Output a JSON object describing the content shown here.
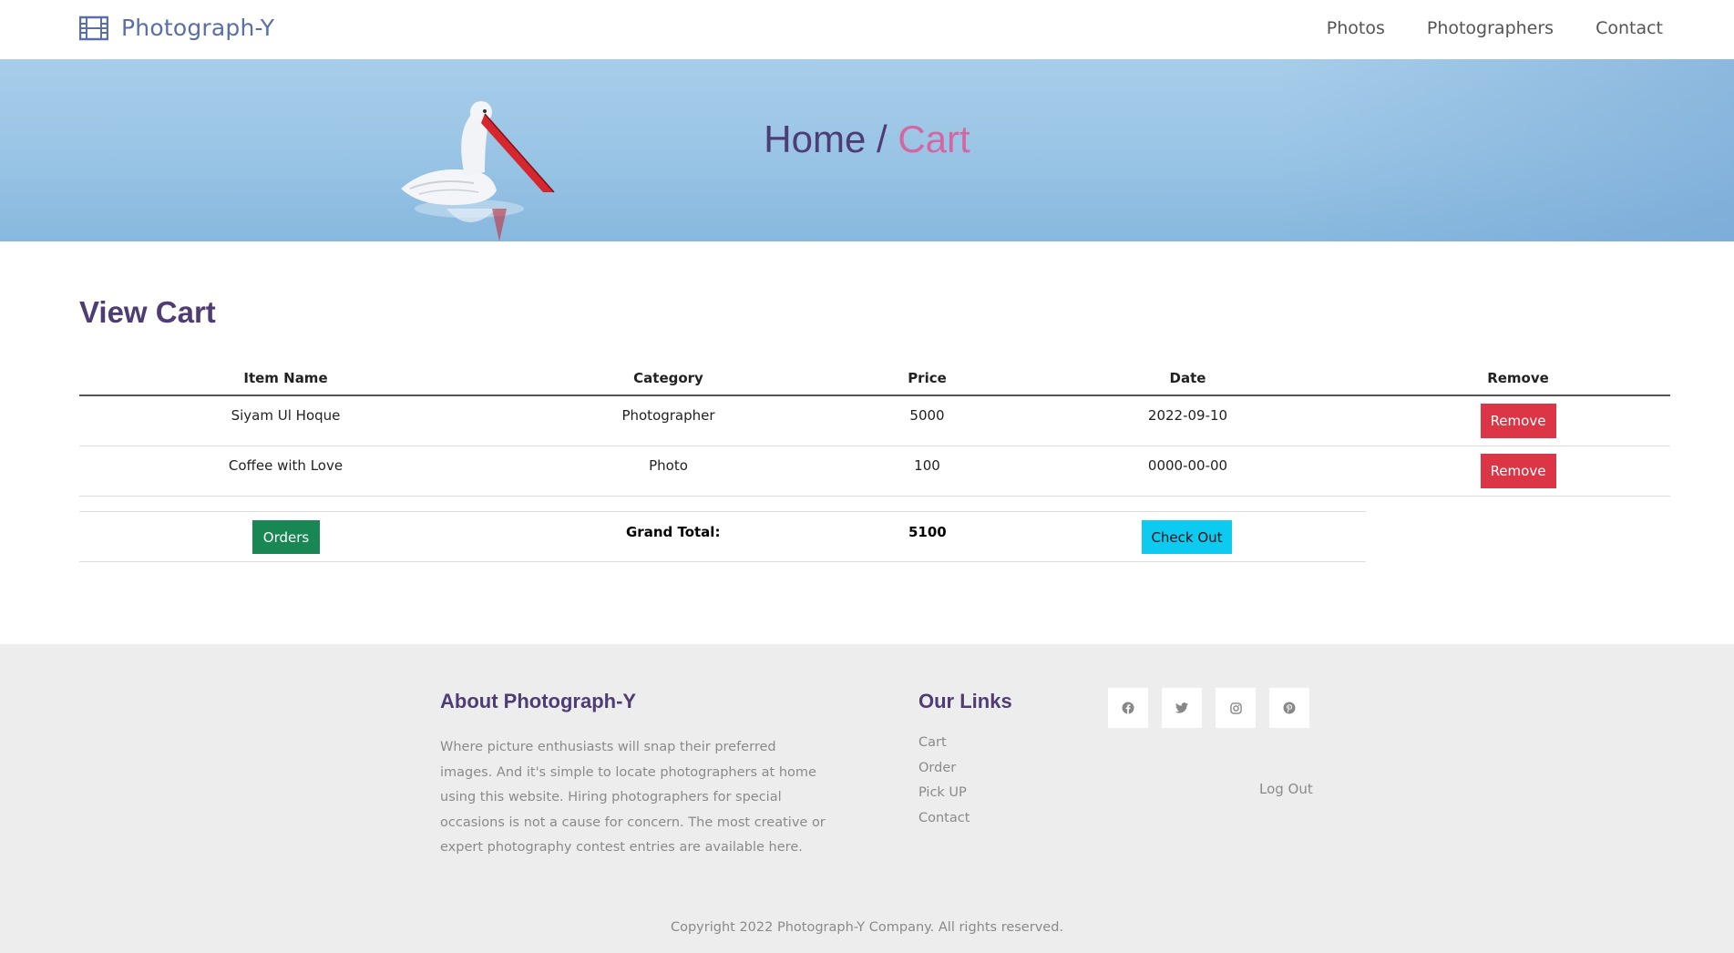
{
  "navbar": {
    "brand": "Photograph-Y",
    "brand_icon": "film-icon",
    "links": [
      "Photos",
      "Photographers",
      "Contact"
    ]
  },
  "hero": {
    "home": "Home",
    "separator": " / ",
    "current": "Cart"
  },
  "cart": {
    "title": "View Cart",
    "columns": [
      "Item Name",
      "Category",
      "Price",
      "Date",
      "Remove"
    ],
    "rows": [
      {
        "item": "Siyam Ul Hoque",
        "category": "Photographer",
        "price": "5000",
        "date": "2022-09-10",
        "remove_label": "Remove"
      },
      {
        "item": "Coffee with Love",
        "category": "Photo",
        "price": "100",
        "date": "0000-00-00",
        "remove_label": "Remove"
      }
    ],
    "orders_label": "Orders",
    "grand_total_label": "Grand Total:",
    "grand_total_value": "5100",
    "checkout_label": "Check Out"
  },
  "footer": {
    "about_title": "About Photograph-Y",
    "about_text": "Where picture enthusiasts will snap their preferred images. And it's simple to locate photographers at home using this website. Hiring photographers for special occasions is not a cause for concern. The most creative or expert photography contest entries are available here.",
    "links_title": "Our Links",
    "links": [
      "Cart",
      "Order",
      "Pick UP",
      "Contact"
    ],
    "socials": [
      "facebook-icon",
      "twitter-icon",
      "instagram-icon",
      "pinterest-icon"
    ],
    "logout": "Log Out",
    "copyright": "Copyright 2022 Photograph-Y Company. All rights reserved."
  },
  "colors": {
    "brand": "#5a6ea8",
    "heading": "#4e3d75",
    "accent_pink": "#d466a1",
    "remove": "#dc3545",
    "orders": "#198754",
    "checkout": "#0dcaf0"
  }
}
